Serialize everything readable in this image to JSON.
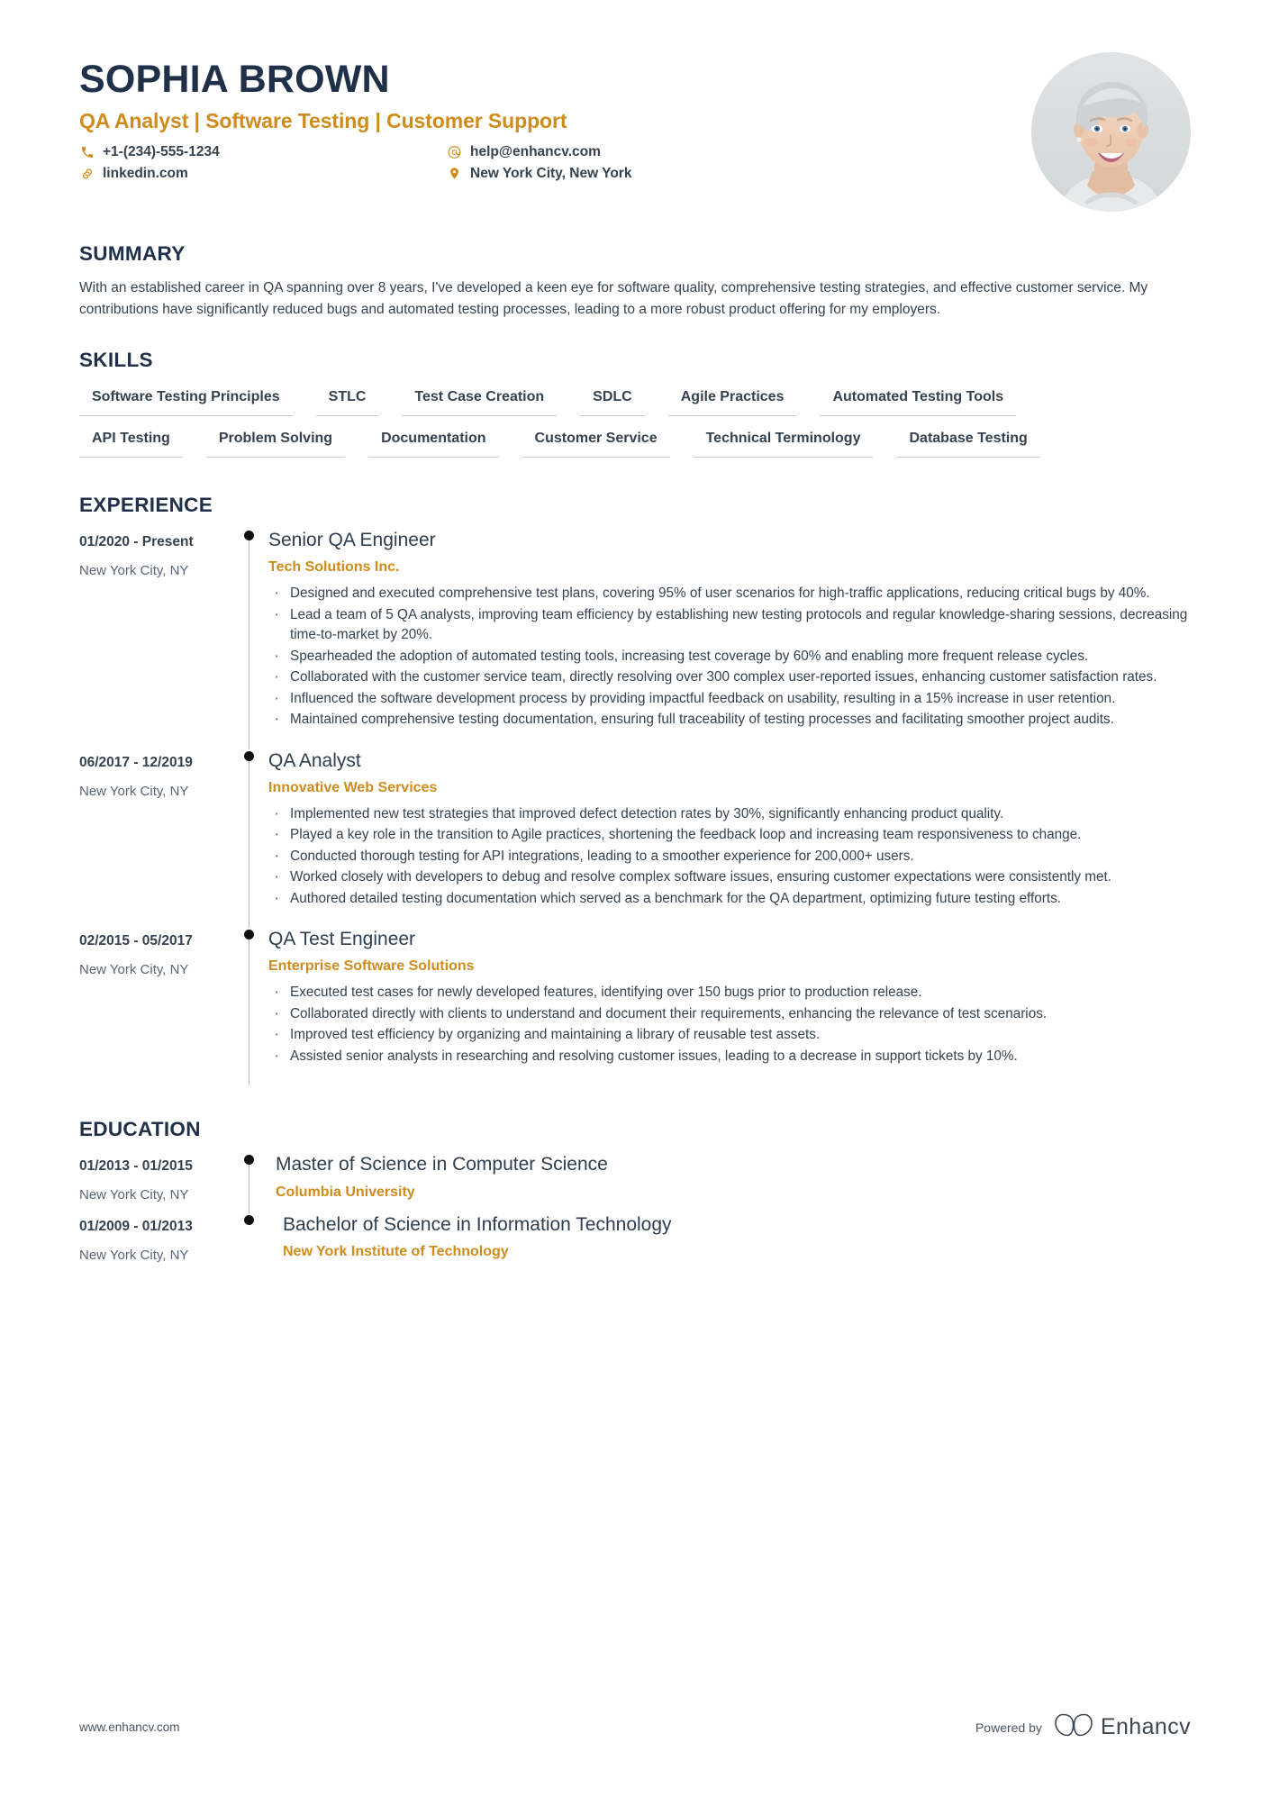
{
  "colors": {
    "accent": "#cf8b1b",
    "heading": "#1f3048",
    "text": "#35424f",
    "rail": "#b9bec4",
    "dot": "#111111"
  },
  "header": {
    "full_name": "SOPHIA BROWN",
    "job_title": "QA Analyst | Software Testing | Customer Support",
    "contacts_left": [
      {
        "icon": "phone-icon",
        "value": "+1-(234)-555-1234"
      },
      {
        "icon": "link-icon",
        "value": "linkedin.com"
      }
    ],
    "contacts_right": [
      {
        "icon": "email-icon",
        "value": "help@enhancv.com"
      },
      {
        "icon": "location-pin-icon",
        "value": "New York City, New York"
      }
    ],
    "avatar_alt": "profile-photo"
  },
  "summary": {
    "heading": "SUMMARY",
    "text": "With an established career in QA spanning over 8 years, I've developed a keen eye for software quality, comprehensive testing strategies, and effective customer service. My contributions have significantly reduced bugs and automated testing processes, leading to a more robust product offering for my employers."
  },
  "skills": {
    "heading": "SKILLS",
    "rows": [
      [
        "Software Testing Principles",
        "STLC",
        "Test Case Creation",
        "SDLC",
        "Agile Practices",
        "Automated Testing Tools"
      ],
      [
        "API Testing",
        "Problem Solving",
        "Documentation",
        "Customer Service",
        "Technical Terminology",
        "Database Testing"
      ]
    ]
  },
  "experience": {
    "heading": "EXPERIENCE",
    "entries": [
      {
        "date": "01/2020 - Present",
        "location": "New York City, NY",
        "title": "Senior QA Engineer",
        "org": "Tech Solutions Inc.",
        "bullets": [
          "Designed and executed comprehensive test plans, covering 95% of user scenarios for high-traffic applications, reducing critical bugs by 40%.",
          "Lead a team of 5 QA analysts, improving team efficiency by establishing new testing protocols and regular knowledge-sharing sessions, decreasing time-to-market by 20%.",
          "Spearheaded the adoption of automated testing tools, increasing test coverage by 60% and enabling more frequent release cycles.",
          "Collaborated with the customer service team, directly resolving over 300 complex user-reported issues, enhancing customer satisfaction rates.",
          "Influenced the software development process by providing impactful feedback on usability, resulting in a 15% increase in user retention.",
          "Maintained comprehensive testing documentation, ensuring full traceability of testing processes and facilitating smoother project audits."
        ]
      },
      {
        "date": "06/2017 - 12/2019",
        "location": "New York City, NY",
        "title": "QA Analyst",
        "org": "Innovative Web Services",
        "bullets": [
          "Implemented new test strategies that improved defect detection rates by 30%, significantly enhancing product quality.",
          "Played a key role in the transition to Agile practices, shortening the feedback loop and increasing team responsiveness to change.",
          "Conducted thorough testing for API integrations, leading to a smoother experience for 200,000+ users.",
          "Worked closely with developers to debug and resolve complex software issues, ensuring customer expectations were consistently met.",
          "Authored detailed testing documentation which served as a benchmark for the QA department, optimizing future testing efforts."
        ]
      },
      {
        "date": "02/2015 - 05/2017",
        "location": "New York City, NY",
        "title": "QA Test Engineer",
        "org": "Enterprise Software Solutions",
        "bullets": [
          "Executed test cases for newly developed features, identifying over 150 bugs prior to production release.",
          "Collaborated directly with clients to understand and document their requirements, enhancing the relevance of test scenarios.",
          "Improved test efficiency by organizing and maintaining a library of reusable test assets.",
          "Assisted senior analysts in researching and resolving customer issues, leading to a decrease in support tickets by 10%."
        ]
      }
    ]
  },
  "education": {
    "heading": "EDUCATION",
    "entries": [
      {
        "date": "01/2013 - 01/2015",
        "location": "New York City, NY",
        "title": "Master of Science in Computer Science",
        "org": "Columbia University"
      },
      {
        "date": "01/2009 - 01/2013",
        "location": "New York City, NY",
        "title": "Bachelor of Science in Information Technology",
        "org": "New York Institute of Technology"
      }
    ]
  },
  "footer": {
    "url": "www.enhancv.com",
    "powered_by": "Powered by",
    "brand": "Enhancv"
  }
}
